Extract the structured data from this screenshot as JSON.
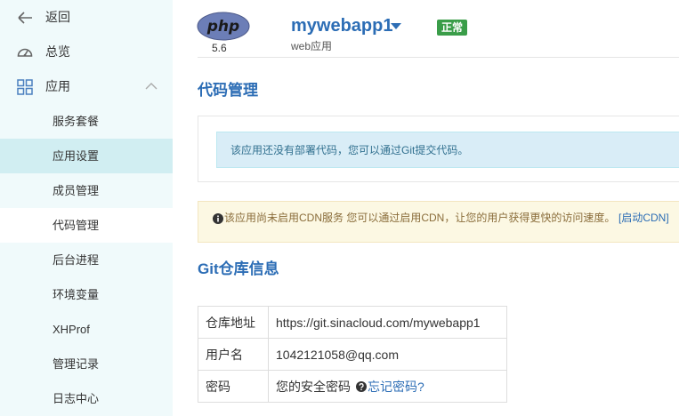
{
  "sidebar": {
    "back_label": "返回",
    "overview_label": "总览",
    "apps_label": "应用",
    "sub_items": [
      {
        "label": "服务套餐"
      },
      {
        "label": "应用设置"
      },
      {
        "label": "成员管理"
      },
      {
        "label": "代码管理"
      },
      {
        "label": "后台进程"
      },
      {
        "label": "环境变量"
      },
      {
        "label": "XHProf"
      },
      {
        "label": "管理记录"
      },
      {
        "label": "日志中心"
      }
    ]
  },
  "header": {
    "logo_text": "php",
    "runtime_version": "5.6",
    "app_name": "mywebapp1",
    "app_type": "web应用",
    "status": "正常"
  },
  "code_section": {
    "title": "代码管理",
    "notice": "该应用还没有部署代码，您可以通过Git提交代码。"
  },
  "cdn_notice": {
    "text": "该应用尚未启用CDN服务 您可以通过启用CDN，让您的用户获得更快的访问速度。",
    "link_label": "[启动CDN]"
  },
  "git_section": {
    "title": "Git仓库信息",
    "rows": [
      {
        "key": "仓库地址",
        "value": "https://git.sinacloud.com/mywebapp1"
      },
      {
        "key": "用户名",
        "value": "1042121058@qq.com"
      },
      {
        "key": "密码",
        "value": "您的安全密码",
        "link_label": "忘记密码?"
      }
    ]
  },
  "colors": {
    "sidebar_bg": "#f0fafb",
    "sidebar_selected": "#d1eef2",
    "brand_blue": "#2c6db5",
    "status_green": "#3a9d49",
    "info_bg": "#d9edf7",
    "warning_bg": "#fcf8e3"
  },
  "icons": {
    "back": "arrow-left-icon",
    "overview": "dashboard-icon",
    "apps": "grid-icon",
    "apps_toggle": "chevron-up-icon",
    "app_switcher": "caret-down-icon",
    "cdn_notice": "info-circle-icon",
    "password_help": "question-circle-icon"
  }
}
